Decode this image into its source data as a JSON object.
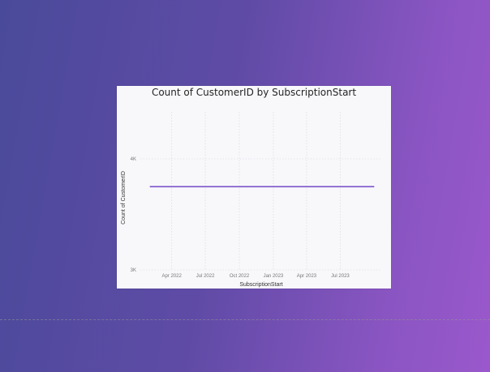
{
  "chart_data": {
    "type": "line",
    "title": "Count of CustomerID by SubscriptionStart",
    "xlabel": "SubscriptionStart",
    "ylabel": "Count of CustomerID",
    "x_ticks": [
      "Apr 2022",
      "Jul 2022",
      "Oct 2022",
      "Jan 2023",
      "Apr 2023",
      "Jul 2023"
    ],
    "y_ticks": [
      "3K",
      "4K"
    ],
    "ylim": [
      3000,
      4000
    ],
    "xlim": [
      "2022-01-15",
      "2023-10-20"
    ],
    "grid": true,
    "series": [
      {
        "color": "#7a52c9",
        "points": [
          {
            "x": "2022-02-01",
            "y": 3750
          },
          {
            "x": "2023-10-01",
            "y": 3750
          }
        ]
      }
    ]
  }
}
